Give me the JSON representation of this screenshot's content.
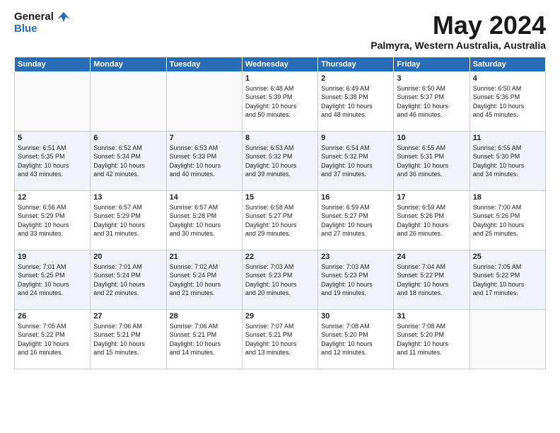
{
  "logo": {
    "line1": "General",
    "line2": "Blue"
  },
  "title": "May 2024",
  "location": "Palmyra, Western Australia, Australia",
  "headers": [
    "Sunday",
    "Monday",
    "Tuesday",
    "Wednesday",
    "Thursday",
    "Friday",
    "Saturday"
  ],
  "weeks": [
    [
      {
        "day": "",
        "info": ""
      },
      {
        "day": "",
        "info": ""
      },
      {
        "day": "",
        "info": ""
      },
      {
        "day": "1",
        "info": "Sunrise: 6:48 AM\nSunset: 5:39 PM\nDaylight: 10 hours\nand 50 minutes."
      },
      {
        "day": "2",
        "info": "Sunrise: 6:49 AM\nSunset: 5:38 PM\nDaylight: 10 hours\nand 48 minutes."
      },
      {
        "day": "3",
        "info": "Sunrise: 6:50 AM\nSunset: 5:37 PM\nDaylight: 10 hours\nand 46 minutes."
      },
      {
        "day": "4",
        "info": "Sunrise: 6:50 AM\nSunset: 5:36 PM\nDaylight: 10 hours\nand 45 minutes."
      }
    ],
    [
      {
        "day": "5",
        "info": "Sunrise: 6:51 AM\nSunset: 5:35 PM\nDaylight: 10 hours\nand 43 minutes."
      },
      {
        "day": "6",
        "info": "Sunrise: 6:52 AM\nSunset: 5:34 PM\nDaylight: 10 hours\nand 42 minutes."
      },
      {
        "day": "7",
        "info": "Sunrise: 6:53 AM\nSunset: 5:33 PM\nDaylight: 10 hours\nand 40 minutes."
      },
      {
        "day": "8",
        "info": "Sunrise: 6:53 AM\nSunset: 5:32 PM\nDaylight: 10 hours\nand 39 minutes."
      },
      {
        "day": "9",
        "info": "Sunrise: 6:54 AM\nSunset: 5:32 PM\nDaylight: 10 hours\nand 37 minutes."
      },
      {
        "day": "10",
        "info": "Sunrise: 6:55 AM\nSunset: 5:31 PM\nDaylight: 10 hours\nand 36 minutes."
      },
      {
        "day": "11",
        "info": "Sunrise: 6:55 AM\nSunset: 5:30 PM\nDaylight: 10 hours\nand 34 minutes."
      }
    ],
    [
      {
        "day": "12",
        "info": "Sunrise: 6:56 AM\nSunset: 5:29 PM\nDaylight: 10 hours\nand 33 minutes."
      },
      {
        "day": "13",
        "info": "Sunrise: 6:57 AM\nSunset: 5:29 PM\nDaylight: 10 hours\nand 31 minutes."
      },
      {
        "day": "14",
        "info": "Sunrise: 6:57 AM\nSunset: 5:28 PM\nDaylight: 10 hours\nand 30 minutes."
      },
      {
        "day": "15",
        "info": "Sunrise: 6:58 AM\nSunset: 5:27 PM\nDaylight: 10 hours\nand 29 minutes."
      },
      {
        "day": "16",
        "info": "Sunrise: 6:59 AM\nSunset: 5:27 PM\nDaylight: 10 hours\nand 27 minutes."
      },
      {
        "day": "17",
        "info": "Sunrise: 6:59 AM\nSunset: 5:26 PM\nDaylight: 10 hours\nand 26 minutes."
      },
      {
        "day": "18",
        "info": "Sunrise: 7:00 AM\nSunset: 5:26 PM\nDaylight: 10 hours\nand 25 minutes."
      }
    ],
    [
      {
        "day": "19",
        "info": "Sunrise: 7:01 AM\nSunset: 5:25 PM\nDaylight: 10 hours\nand 24 minutes."
      },
      {
        "day": "20",
        "info": "Sunrise: 7:01 AM\nSunset: 5:24 PM\nDaylight: 10 hours\nand 22 minutes."
      },
      {
        "day": "21",
        "info": "Sunrise: 7:02 AM\nSunset: 5:24 PM\nDaylight: 10 hours\nand 21 minutes."
      },
      {
        "day": "22",
        "info": "Sunrise: 7:03 AM\nSunset: 5:23 PM\nDaylight: 10 hours\nand 20 minutes."
      },
      {
        "day": "23",
        "info": "Sunrise: 7:03 AM\nSunset: 5:23 PM\nDaylight: 10 hours\nand 19 minutes."
      },
      {
        "day": "24",
        "info": "Sunrise: 7:04 AM\nSunset: 5:22 PM\nDaylight: 10 hours\nand 18 minutes."
      },
      {
        "day": "25",
        "info": "Sunrise: 7:05 AM\nSunset: 5:22 PM\nDaylight: 10 hours\nand 17 minutes."
      }
    ],
    [
      {
        "day": "26",
        "info": "Sunrise: 7:05 AM\nSunset: 5:22 PM\nDaylight: 10 hours\nand 16 minutes."
      },
      {
        "day": "27",
        "info": "Sunrise: 7:06 AM\nSunset: 5:21 PM\nDaylight: 10 hours\nand 15 minutes."
      },
      {
        "day": "28",
        "info": "Sunrise: 7:06 AM\nSunset: 5:21 PM\nDaylight: 10 hours\nand 14 minutes."
      },
      {
        "day": "29",
        "info": "Sunrise: 7:07 AM\nSunset: 5:21 PM\nDaylight: 10 hours\nand 13 minutes."
      },
      {
        "day": "30",
        "info": "Sunrise: 7:08 AM\nSunset: 5:20 PM\nDaylight: 10 hours\nand 12 minutes."
      },
      {
        "day": "31",
        "info": "Sunrise: 7:08 AM\nSunset: 5:20 PM\nDaylight: 10 hours\nand 11 minutes."
      },
      {
        "day": "",
        "info": ""
      }
    ]
  ]
}
